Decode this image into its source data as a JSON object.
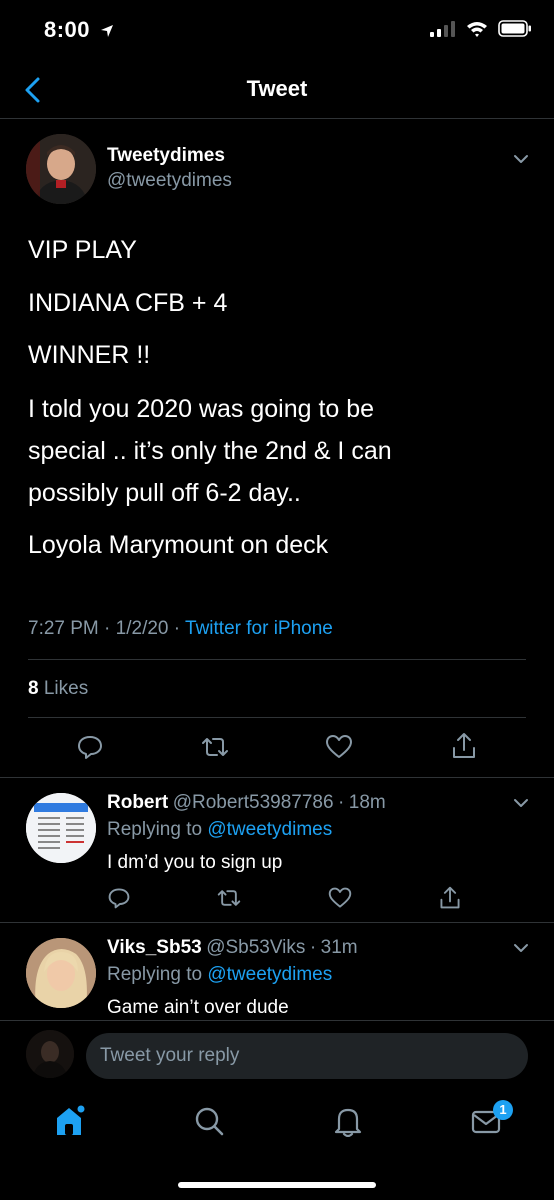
{
  "status_bar": {
    "time": "8:00"
  },
  "header": {
    "title": "Tweet"
  },
  "tweet": {
    "author_name": "Tweetydimes",
    "author_handle": "@tweetydimes",
    "lines": [
      "VIP PLAY",
      "INDIANA CFB + 4",
      "WINNER !!",
      "I told you 2020 was going to be",
      "special .. it’s only the 2nd & I can",
      "possibly pull off 6-2 day..",
      "Loyola Marymount on deck"
    ],
    "time": "7:27 PM",
    "date": "1/2/20",
    "source": "Twitter for iPhone",
    "likes_count": "8",
    "likes_label": "Likes"
  },
  "replies": [
    {
      "name": "Robert",
      "handle": "@Robert53987786",
      "age": "18m",
      "replying_label": "Replying to",
      "replying_to": "@tweetydimes",
      "text": "I dm’d you to sign up"
    },
    {
      "name": "Viks_Sb53",
      "handle": "@Sb53Viks",
      "age": "31m",
      "replying_label": "Replying to",
      "replying_to": "@tweetydimes",
      "text": "Game ain’t over dude"
    }
  ],
  "compose": {
    "placeholder": "Tweet your reply"
  },
  "tab_bar": {
    "messages_badge": "1"
  },
  "colors": {
    "background": "#000000",
    "accent": "#1da1f2",
    "secondary_text": "#8899a6",
    "divider": "#2f3336"
  }
}
